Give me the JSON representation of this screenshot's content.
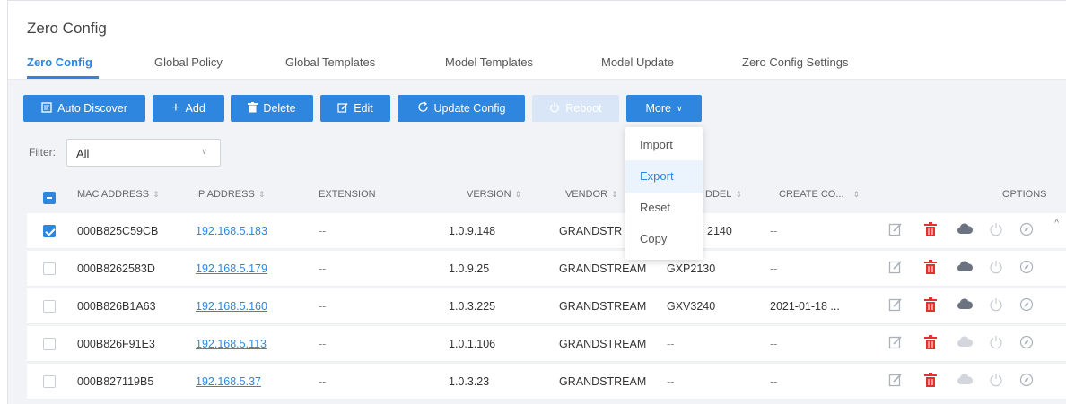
{
  "page": {
    "title": "Zero Config"
  },
  "tabs": [
    {
      "label": "Zero Config",
      "active": true
    },
    {
      "label": "Global Policy",
      "active": false
    },
    {
      "label": "Global Templates",
      "active": false
    },
    {
      "label": "Model Templates",
      "active": false
    },
    {
      "label": "Model Update",
      "active": false
    },
    {
      "label": "Zero Config Settings",
      "active": false
    }
  ],
  "toolbar": {
    "auto_discover": "Auto Discover",
    "add": "Add",
    "delete": "Delete",
    "edit": "Edit",
    "update_config": "Update Config",
    "reboot": "Reboot",
    "more": "More"
  },
  "filter": {
    "label": "Filter:",
    "value": "All"
  },
  "table": {
    "headers": {
      "mac": "MAC ADDRESS",
      "ip": "IP ADDRESS",
      "extension": "EXTENSION",
      "version": "VERSION",
      "vendor": "VENDOR",
      "model": "DDEL",
      "create": "CREATE CO...",
      "options": "OPTIONS"
    },
    "rows": [
      {
        "checked": true,
        "mac": "000B825C59CB",
        "ip": "192.168.5.183",
        "extension": "--",
        "version": "1.0.9.148",
        "vendor": "GRANDSTR",
        "model": "2140",
        "create": "--",
        "cloud_active": true
      },
      {
        "checked": false,
        "mac": "000B8262583D",
        "ip": "192.168.5.179",
        "extension": "--",
        "version": "1.0.9.25",
        "vendor": "GRANDSTREAM",
        "model": "GXP2130",
        "create": "--",
        "cloud_active": true
      },
      {
        "checked": false,
        "mac": "000B826B1A63",
        "ip": "192.168.5.160",
        "extension": "--",
        "version": "1.0.3.225",
        "vendor": "GRANDSTREAM",
        "model": "GXV3240",
        "create": "2021-01-18 ...",
        "cloud_active": true
      },
      {
        "checked": false,
        "mac": "000B826F91E3",
        "ip": "192.168.5.113",
        "extension": "--",
        "version": "1.0.1.106",
        "vendor": "GRANDSTREAM",
        "model": "--",
        "create": "--",
        "cloud_active": false
      },
      {
        "checked": false,
        "mac": "000B827119B5",
        "ip": "192.168.5.37",
        "extension": "--",
        "version": "1.0.3.23",
        "vendor": "GRANDSTREAM",
        "model": "--",
        "create": "--",
        "cloud_active": false
      }
    ]
  },
  "more_menu": {
    "items": [
      "Import",
      "Export",
      "Reset",
      "Copy"
    ],
    "highlighted": "Export"
  },
  "colors": {
    "accent": "#2e86de",
    "delete": "#e0322f",
    "disabled": "#d8e6f7"
  },
  "icons": [
    "auto-discover-icon",
    "plus-icon",
    "trash-icon",
    "edit-icon",
    "refresh-icon",
    "power-icon",
    "chevron-down-icon",
    "cloud-icon",
    "compass-icon"
  ]
}
